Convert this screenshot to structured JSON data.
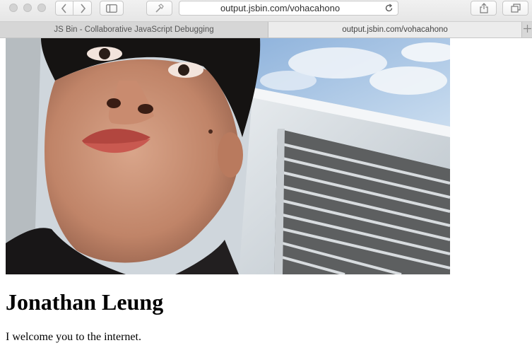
{
  "browser": {
    "url": "output.jsbin.com/vohacahono",
    "tabs": [
      {
        "label": "JS Bin - Collaborative JavaScript Debugging",
        "active": false
      },
      {
        "label": "output.jsbin.com/vohacahono",
        "active": true
      }
    ],
    "icons": {
      "back": "chevron-left-icon",
      "forward": "chevron-right-icon",
      "sidebar": "sidebar-icon",
      "tools": "hammer-icon",
      "reload": "reload-icon",
      "share": "share-icon",
      "tabs": "tabs-overview-icon",
      "new_tab": "plus-icon"
    }
  },
  "page": {
    "image_description_icon": "profile-photo",
    "heading": "Jonathan Leung",
    "paragraph": "I welcome you to the internet."
  }
}
